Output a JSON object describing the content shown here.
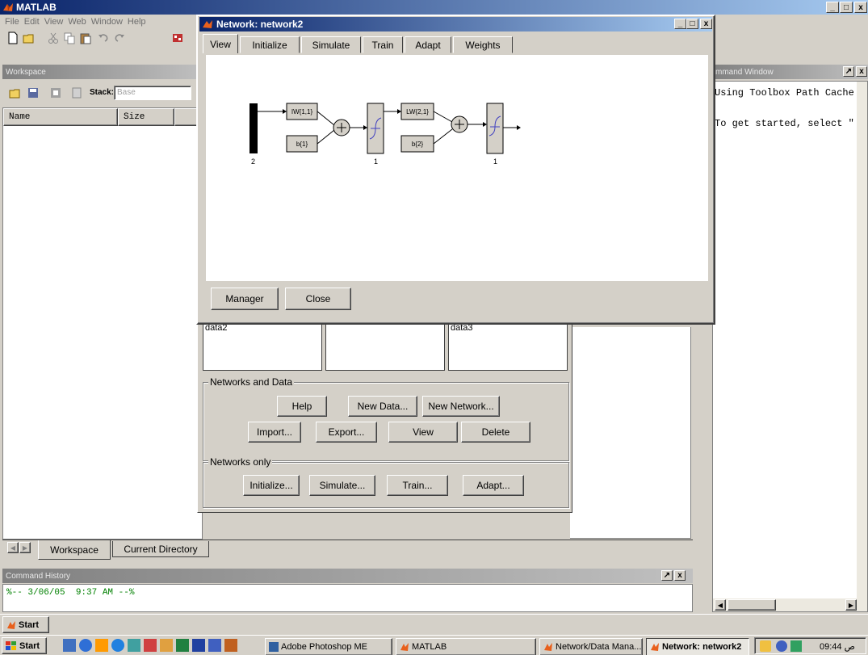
{
  "matlab": {
    "title": "MATLAB",
    "menu": [
      "File",
      "Edit",
      "View",
      "Web",
      "Window",
      "Help"
    ]
  },
  "workspace": {
    "panel_title": "Workspace",
    "stack_label": "Stack:",
    "stack_value": "Base",
    "col_name": "Name",
    "col_size": "Size",
    "tabs": [
      "Workspace",
      "Current Directory"
    ]
  },
  "command_history": {
    "title": "Command History",
    "entry": "%-- 3/06/05  9:37 AM --%"
  },
  "command_window": {
    "title": "mmand Window",
    "line1": "Using Toolbox Path Cache",
    "line2": "To get started, select \""
  },
  "nntool": {
    "data2_label": "data2",
    "data3_label": "data3",
    "group1": "Networks and Data",
    "group2": "Networks only",
    "buttons_row1": [
      "Help",
      "New Data...",
      "New Network..."
    ],
    "buttons_row2": [
      "Import...",
      "Export...",
      "View",
      "Delete"
    ],
    "buttons_row3": [
      "Initialize...",
      "Simulate...",
      "Train...",
      "Adapt..."
    ]
  },
  "network_window": {
    "title": "Network: network2",
    "tabs": [
      "View",
      "Initialize",
      "Simulate",
      "Train",
      "Adapt",
      "Weights"
    ],
    "diagram": {
      "iw": "IW{1,1}",
      "b1": "b{1}",
      "lw": "LW{2,1}",
      "b2": "b{2}",
      "input_size": "2",
      "layer1_size": "1",
      "layer2_size": "1"
    },
    "manager_label": "Manager",
    "close_label": "Close"
  },
  "start_mini": "Start",
  "taskbar": {
    "start": "Start",
    "tasks": [
      "Adobe Photoshop ME",
      "MATLAB",
      "Network/Data Mana...",
      "Network: network2"
    ],
    "clock": "09:44 ص"
  },
  "colors": {
    "active_title": "#0a246a",
    "history_text": "#008000",
    "face": "#d4d0c8"
  }
}
